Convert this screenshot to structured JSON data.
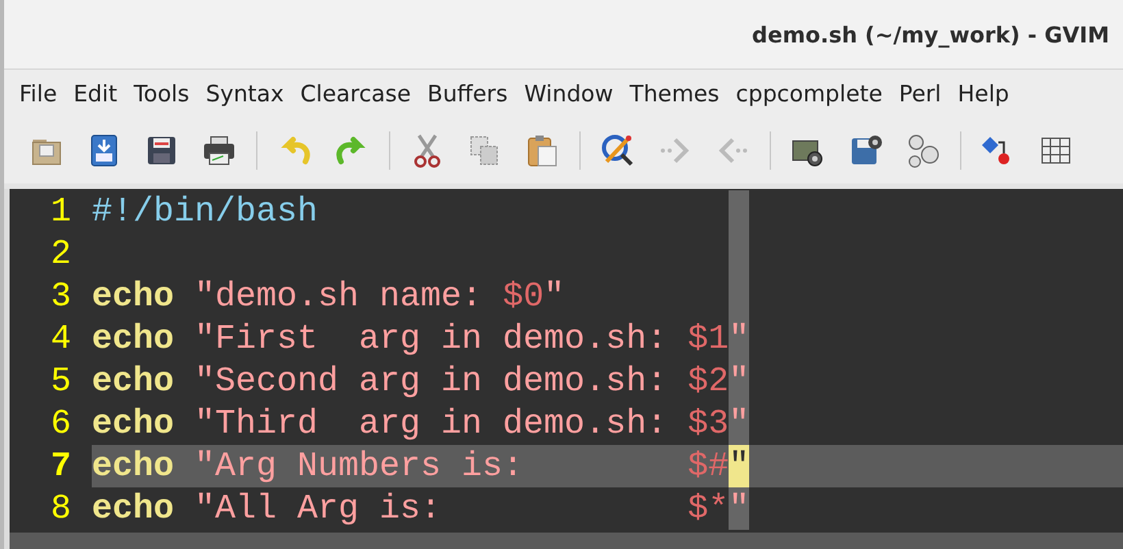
{
  "window": {
    "title": "demo.sh (~/my_work) - GVIM"
  },
  "menu": [
    "File",
    "Edit",
    "Tools",
    "Syntax",
    "Clearcase",
    "Buffers",
    "Window",
    "Themes",
    "cppcomplete",
    "Perl",
    "Help"
  ],
  "editor": {
    "lines": [
      {
        "number": "1",
        "current": false,
        "segments": [
          {
            "kind": "comment",
            "text": "#!/bin/bash"
          }
        ]
      },
      {
        "number": "2",
        "current": false
      },
      {
        "number": "3",
        "current": false,
        "segments": [
          {
            "kind": "keyword",
            "text": "echo"
          },
          {
            "kind": "string",
            "text": " \"demo.sh name: "
          },
          {
            "kind": "variable",
            "text": "$0"
          },
          {
            "kind": "string",
            "text": "\""
          }
        ]
      },
      {
        "number": "4",
        "current": false,
        "segments": [
          {
            "kind": "keyword",
            "text": "echo"
          },
          {
            "kind": "string",
            "text": " \"First  arg in demo.sh: "
          },
          {
            "kind": "variable",
            "text": "$1"
          },
          {
            "kind": "string",
            "text": "\""
          }
        ]
      },
      {
        "number": "5",
        "current": false,
        "segments": [
          {
            "kind": "keyword",
            "text": "echo"
          },
          {
            "kind": "string",
            "text": " \"Second arg in demo.sh: "
          },
          {
            "kind": "variable",
            "text": "$2"
          },
          {
            "kind": "string",
            "text": "\""
          }
        ]
      },
      {
        "number": "6",
        "current": false,
        "segments": [
          {
            "kind": "keyword",
            "text": "echo"
          },
          {
            "kind": "string",
            "text": " \"Third  arg in demo.sh: "
          },
          {
            "kind": "variable",
            "text": "$3"
          },
          {
            "kind": "string",
            "text": "\""
          }
        ]
      },
      {
        "number": "7",
        "current": true,
        "segments": [
          {
            "kind": "keyword",
            "text": "echo"
          },
          {
            "kind": "string",
            "text": " \"Arg Numbers is:        "
          },
          {
            "kind": "variable",
            "text": "$#"
          },
          {
            "kind": "cursor",
            "text": "\""
          }
        ]
      },
      {
        "number": "8",
        "current": false,
        "segments": [
          {
            "kind": "keyword",
            "text": "echo"
          },
          {
            "kind": "string",
            "text": " \"All Arg is:            "
          },
          {
            "kind": "variable",
            "text": "$*"
          },
          {
            "kind": "string",
            "text": "\""
          }
        ]
      }
    ]
  }
}
